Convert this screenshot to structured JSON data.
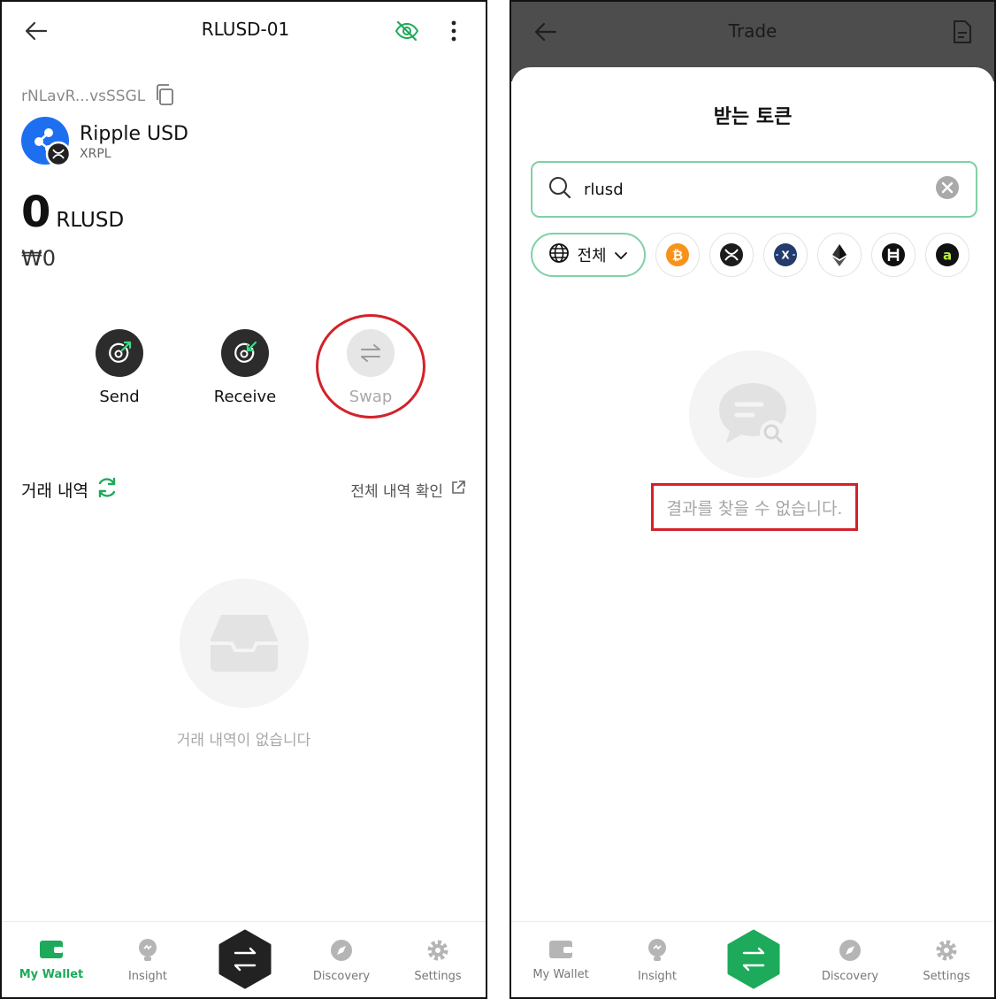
{
  "left": {
    "header": {
      "title": "RLUSD-01"
    },
    "address": "rNLavR...vsSSGL",
    "token": {
      "name": "Ripple USD",
      "chain": "XRPL"
    },
    "balance": {
      "amount": "0",
      "symbol": "RLUSD",
      "fiat": "₩0"
    },
    "actions": {
      "send": "Send",
      "receive": "Receive",
      "swap": "Swap"
    },
    "history": {
      "title": "거래 내역",
      "view_all": "전체 내역 확인",
      "empty": "거래 내역이 없습니다"
    }
  },
  "right": {
    "header": {
      "title": "Trade"
    },
    "sheet": {
      "title": "받는 토큰"
    },
    "search": {
      "value": "rlusd"
    },
    "filter": {
      "all_label": "전체"
    },
    "networks": [
      "bitcoin-icon",
      "xrp-icon",
      "xdc-icon",
      "ethereum-icon",
      "hedera-icon",
      "avail-icon"
    ],
    "empty": "결과를 찾을 수 없습니다."
  },
  "tabs": {
    "wallet": "My Wallet",
    "insight": "Insight",
    "discovery": "Discovery",
    "settings": "Settings"
  },
  "colors": {
    "accent": "#1daa5a",
    "highlight": "#d3222a",
    "dark": "#2c2c2c"
  }
}
